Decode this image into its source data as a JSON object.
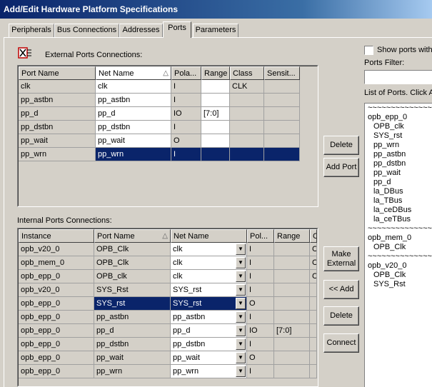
{
  "window": {
    "title": "Add/Edit Hardware Platform Specifications"
  },
  "tabs": [
    "Peripherals",
    "Bus Connections",
    "Addresses",
    "Ports",
    "Parameters"
  ],
  "external": {
    "label": "External Ports Connections:",
    "columns": [
      "Port Name",
      "Net Name",
      "Pola...",
      "Range",
      "Class",
      "Sensit..."
    ],
    "rows": [
      [
        "clk",
        "clk",
        "I",
        "",
        "CLK",
        ""
      ],
      [
        "pp_astbn",
        "pp_astbn",
        "I",
        "",
        "",
        ""
      ],
      [
        "pp_d",
        "pp_d",
        "IO",
        "[7:0]",
        "",
        ""
      ],
      [
        "pp_dstbn",
        "pp_dstbn",
        "I",
        "",
        "",
        ""
      ],
      [
        "pp_wait",
        "pp_wait",
        "O",
        "",
        "",
        ""
      ],
      [
        "pp_wrn",
        "pp_wrn",
        "I",
        "",
        "",
        ""
      ]
    ]
  },
  "internal": {
    "label": "Internal Ports Connections:",
    "columns": [
      "Instance",
      "Port Name",
      "Net Name",
      "Pol...",
      "Range",
      "C"
    ],
    "rows": [
      [
        "opb_v20_0",
        "OPB_Clk",
        "clk",
        "I",
        "",
        "C"
      ],
      [
        "opb_mem_0",
        "OPB_Clk",
        "clk",
        "I",
        "",
        "C"
      ],
      [
        "opb_epp_0",
        "OPB_clk",
        "clk",
        "I",
        "",
        "C"
      ],
      [
        "opb_v20_0",
        "SYS_Rst",
        "SYS_rst",
        "I",
        "",
        ""
      ],
      [
        "opb_epp_0",
        "SYS_rst",
        "SYS_rst",
        "O",
        "",
        ""
      ],
      [
        "opb_epp_0",
        "pp_astbn",
        "pp_astbn",
        "I",
        "",
        ""
      ],
      [
        "opb_epp_0",
        "pp_d",
        "pp_d",
        "IO",
        "[7:0]",
        ""
      ],
      [
        "opb_epp_0",
        "pp_dstbn",
        "pp_dstbn",
        "I",
        "",
        ""
      ],
      [
        "opb_epp_0",
        "pp_wait",
        "pp_wait",
        "O",
        "",
        ""
      ],
      [
        "opb_epp_0",
        "pp_wrn",
        "pp_wrn",
        "I",
        "",
        ""
      ]
    ]
  },
  "buttons": {
    "delete_ext": "Delete",
    "add_port": "Add Port",
    "make_external": "Make External",
    "add": "<< Add",
    "delete_int": "Delete",
    "connect": "Connect"
  },
  "right_panel": {
    "show_ports_label": "Show ports with",
    "filter_label": "Ports Filter:",
    "list_label": "List of Ports. Click A",
    "list": [
      {
        "text": "~~~~~~~~~~~~~~~~~~~~~~",
        "indent": false
      },
      {
        "text": "opb_epp_0",
        "indent": false
      },
      {
        "text": "OPB_clk",
        "indent": true
      },
      {
        "text": "SYS_rst",
        "indent": true
      },
      {
        "text": "pp_wrn",
        "indent": true
      },
      {
        "text": "pp_astbn",
        "indent": true
      },
      {
        "text": "pp_dstbn",
        "indent": true
      },
      {
        "text": "pp_wait",
        "indent": true
      },
      {
        "text": "pp_d",
        "indent": true
      },
      {
        "text": "la_DBus",
        "indent": true
      },
      {
        "text": "la_TBus",
        "indent": true
      },
      {
        "text": "la_ceDBus",
        "indent": true
      },
      {
        "text": "la_ceTBus",
        "indent": true
      },
      {
        "text": "~~~~~~~~~~~~~~~~~~~~~~",
        "indent": false
      },
      {
        "text": "opb_mem_0",
        "indent": false
      },
      {
        "text": "OPB_Clk",
        "indent": true
      },
      {
        "text": "~~~~~~~~~~~~~~~~~~~~~~",
        "indent": false
      },
      {
        "text": "opb_v20_0",
        "indent": false
      },
      {
        "text": "OPB_Clk",
        "indent": true
      },
      {
        "text": "SYS_Rst",
        "indent": true
      }
    ]
  }
}
